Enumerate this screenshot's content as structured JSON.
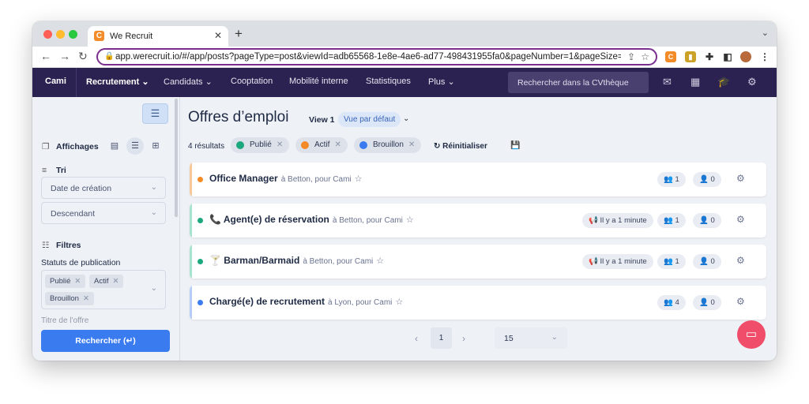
{
  "browser": {
    "tab_title": "We Recruit",
    "tab_favicon": "C",
    "url": "app.werecruit.io/#/app/posts?pageType=post&viewId=adb65568-1e8e-4ae6-ad77-498431955fa0&pageNumber=1&pageSize=1...",
    "new_tab": "+",
    "close": "✕"
  },
  "nav": {
    "items": [
      "Cami",
      "Recrutement",
      "Candidats",
      "Cooptation",
      "Mobilité interne",
      "Statistiques",
      "Plus"
    ],
    "search_placeholder": "Rechercher dans la CVthèque",
    "icons": [
      "mail-icon",
      "calendar-icon",
      "graduation-cap-icon",
      "gear-icon"
    ]
  },
  "sidebar": {
    "affichages": "Affichages",
    "tri": "Tri",
    "sort_field": "Date de création",
    "sort_order": "Descendant",
    "filtres": "Filtres",
    "statuts_label": "Statuts de publication",
    "status_chips": [
      "Publié",
      "Actif",
      "Brouillon"
    ],
    "cut_label": "Titre de l'offre",
    "search_button": "Rechercher",
    "search_button_icon": "(↵)"
  },
  "main": {
    "title": "Offres d’emploi",
    "view_name": "View 1",
    "view_badge": "Vue par défaut",
    "results": "4 résultats",
    "filters": [
      {
        "label": "Publié",
        "color": "#1ba87f"
      },
      {
        "label": "Actif",
        "color": "#f28b28"
      },
      {
        "label": "Brouillon",
        "color": "#3a7bf0"
      }
    ],
    "reset": "Réinitialiser",
    "jobs": [
      {
        "emoji": "",
        "title": "Office Manager",
        "location": "à Betton, pour Cami",
        "status_color": "#f28b28",
        "announce": "",
        "candidates": "1",
        "rejected": "0"
      },
      {
        "emoji": "📞 ",
        "title": "Agent(e) de réservation",
        "location": "à Betton, pour Cami",
        "status_color": "#1ba87f",
        "announce": "Il y a 1 minute",
        "candidates": "1",
        "rejected": "0"
      },
      {
        "emoji": "🍸 ",
        "title": "Barman/Barmaid",
        "location": "à Betton, pour Cami",
        "status_color": "#1ba87f",
        "announce": "Il y a 1 minute",
        "candidates": "1",
        "rejected": "0"
      },
      {
        "emoji": "",
        "title": "Chargé(e) de recrutement",
        "location": "à Lyon, pour Cami",
        "status_color": "#3a7bf0",
        "announce": "",
        "candidates": "4",
        "rejected": "0"
      }
    ],
    "pager": {
      "page": "1",
      "page_size": "15"
    }
  }
}
